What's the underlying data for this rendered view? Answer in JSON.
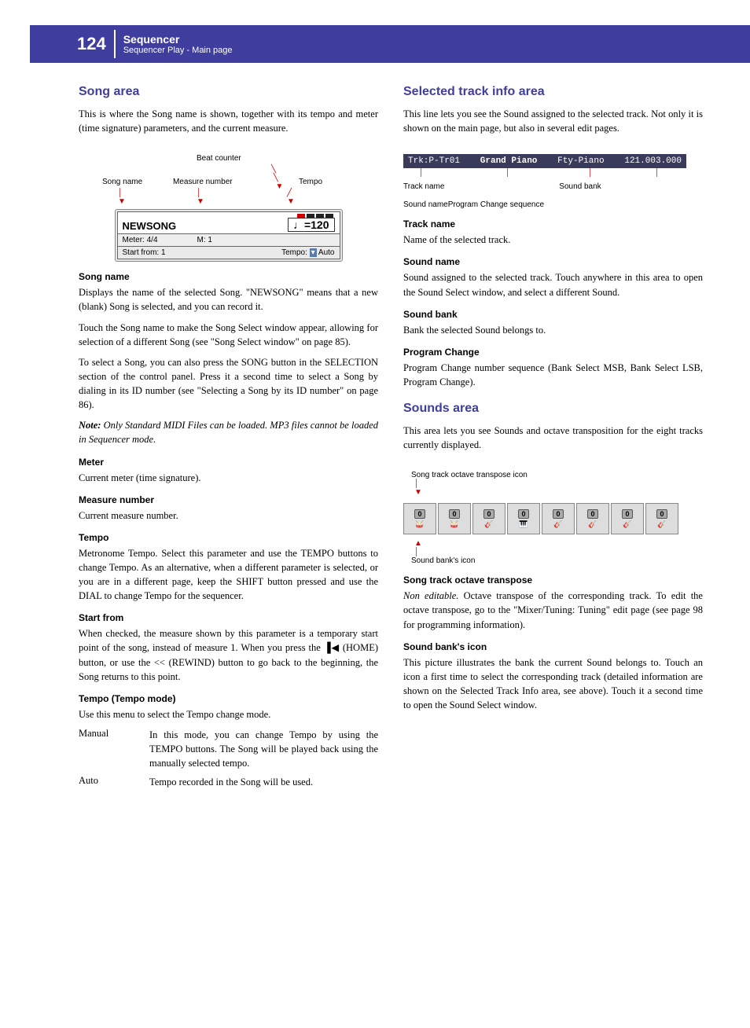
{
  "header": {
    "page_number": "124",
    "title": "Sequencer",
    "subtitle": "Sequencer Play - Main page"
  },
  "left": {
    "h2_song_area": "Song area",
    "song_area_intro": "This is where the Song name is shown, together with its tempo and meter (time signature) parameters, and the current measure.",
    "fig": {
      "beat_counter": "Beat counter",
      "song_name_lbl": "Song name",
      "measure_number_lbl": "Measure number",
      "tempo_lbl": "Tempo",
      "newsong": "NEWSONG",
      "tempo_val": "♩=120",
      "meter_line": "Meter:   4/4",
      "measure_val": "M:   1",
      "start_from": "Start from:  1",
      "tempo_menu": "Tempo:",
      "auto": "Auto"
    },
    "h3_song_name": "Song name",
    "song_name_p1": "Displays the name of the selected Song. \"NEWSONG\" means that a new (blank) Song is selected, and you can record it.",
    "song_name_p2": "Touch the Song name to make the Song Select window appear, allowing for selection of a different Song (see \"Song Select window\" on page 85).",
    "song_name_p3": "To select a Song, you can also press the SONG button in the SELECTION section of the control panel. Press it a second time to select a Song by dialing in its ID number (see \"Selecting a Song by its ID number\" on page 86).",
    "note_label": "Note:",
    "song_name_note": " Only Standard MIDI Files can be loaded. MP3 files cannot be loaded in Sequencer mode.",
    "h3_meter": "Meter",
    "meter_p": "Current meter (time signature).",
    "h3_measure": "Measure number",
    "measure_p": "Current measure number.",
    "h3_tempo": "Tempo",
    "tempo_p": "Metronome Tempo. Select this parameter and use the TEMPO buttons to change Tempo. As an alternative, when a different parameter is selected, or you are in a different page, keep the SHIFT button pressed and use the DIAL to change Tempo for the sequencer.",
    "h3_start_from": "Start from",
    "start_from_p_a": "When checked, the measure shown by this parameter is a temporary start point of the song, instead of measure 1. When you press the ",
    "start_from_p_b": " (HOME) button, or use the << (REWIND) button to go back to the beginning, the Song returns to this point.",
    "h3_tempo_mode": "Tempo (Tempo mode)",
    "tempo_mode_intro": "Use this menu to select the Tempo change mode.",
    "manual_term": "Manual",
    "manual_def": "In this mode, you can change Tempo by using the TEMPO buttons. The Song will be played back using the manually selected tempo.",
    "auto_term": "Auto",
    "auto_def": "Tempo recorded in the Song will be used."
  },
  "right": {
    "h2_selected": "Selected track info area",
    "selected_intro": "This line lets you see the Sound assigned to the selected track. Not only it is shown on the main page, but also in several edit pages.",
    "track_bar": {
      "trk": "Trk:P-Tr01",
      "sound": "Grand Piano",
      "bank": "Fty-Piano",
      "pc": "121.003.000"
    },
    "tlbl_track_name": "Track name",
    "tlbl_sound_bank": "Sound bank",
    "tlbl_sound_name": "Sound name",
    "tlbl_pc": "Program Change sequence",
    "h3_track_name": "Track name",
    "track_name_p": "Name of the selected track.",
    "h3_sound_name": "Sound name",
    "sound_name_p": "Sound assigned to the selected track. Touch anywhere in this area to open the Sound Select window, and select a different Sound.",
    "h3_sound_bank": "Sound bank",
    "sound_bank_p": "Bank the selected Sound belongs to.",
    "h3_pc": "Program Change",
    "pc_p": "Program Change number sequence (Bank Select MSB, Bank Select LSB, Program Change).",
    "h2_sounds": "Sounds area",
    "sounds_intro": "This area lets you see Sounds and octave transposition for the eight tracks currently displayed.",
    "octave_lbl": "Song track octave transpose icon",
    "oct_badge": "0",
    "sound_bank_icon_lbl": "Sound bank's icon",
    "h3_octave": "Song track octave transpose",
    "octave_p_a": "Non editable.",
    "octave_p_b": " Octave transpose of the corresponding track. To edit the octave transpose, go to the \"Mixer/Tuning: Tuning\" edit page (see page 98 for programming information).",
    "h3_sbicon": "Sound bank's icon",
    "sbicon_p": "This picture illustrates the bank the current Sound belongs to. Touch an icon a first time to select the corresponding track (detailed information are shown on the Selected Track Info area, see above). Touch it a second time to open the Sound Select window."
  }
}
